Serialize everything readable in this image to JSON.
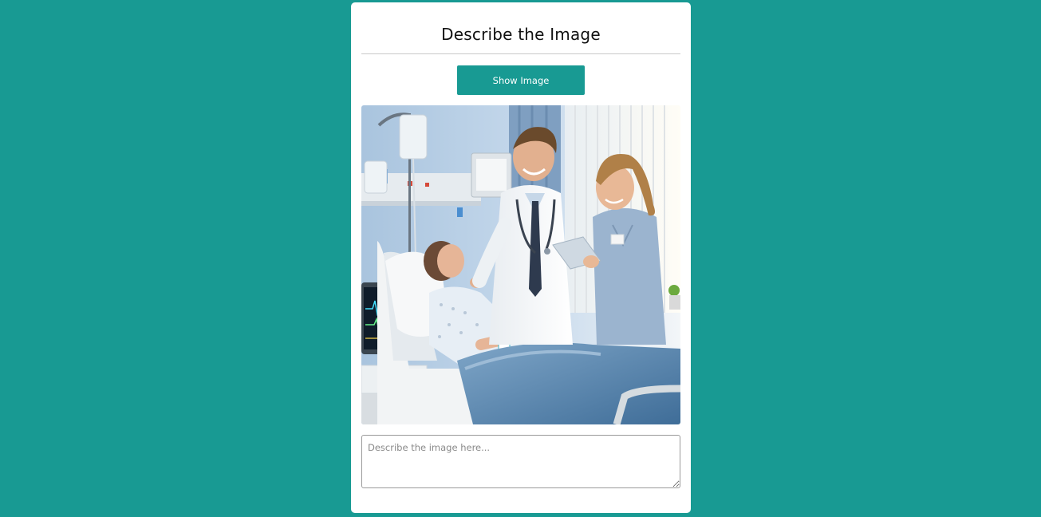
{
  "page": {
    "title": "Describe the Image",
    "show_button_label": "Show Image",
    "textarea_placeholder": "Describe the image here...",
    "textarea_value": ""
  },
  "image": {
    "subject": "hospital-room-doctor-nurse-patient-illustration"
  },
  "colors": {
    "background": "#189a93",
    "accent": "#189a93",
    "card": "#ffffff"
  }
}
